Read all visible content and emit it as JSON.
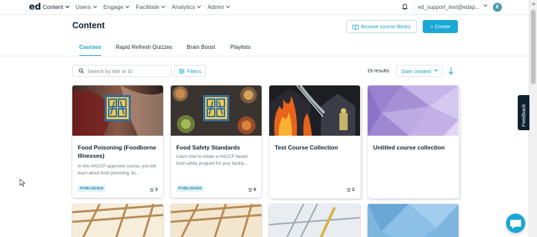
{
  "nav": {
    "logo": "ed",
    "items": [
      {
        "label": "Content",
        "active": true
      },
      {
        "label": "Users",
        "active": false
      },
      {
        "label": "Engage",
        "active": false
      },
      {
        "label": "Facilitate",
        "active": false
      },
      {
        "label": "Analytics",
        "active": false
      },
      {
        "label": "Admin",
        "active": false
      }
    ],
    "user_email": "ed_support_test@edap...",
    "avatar_initial": "E"
  },
  "header": {
    "title": "Content",
    "browse_label": "Browse course library",
    "create_label": "+ Create"
  },
  "tabs": [
    "Courses",
    "Rapid Refresh Quizzes",
    "Brain Boost",
    "Playlists"
  ],
  "active_tab": "Courses",
  "filters": {
    "search_placeholder": "Search by title or ID",
    "filters_label": "Filters",
    "results_text": "19 results",
    "sort_label": "Date created"
  },
  "cards": [
    {
      "title": "Food Poisoning (Foodborne Illnesses)",
      "description": "In this HACCP-approved course, you will learn about food poisoning, its...",
      "status": "PUBLISHED",
      "count": "3",
      "image": "stomach-pain-haccp-logo"
    },
    {
      "title": "Food Safety Standards",
      "description": "Learn how to create a HACCP based food safety program for your facility....",
      "status": "PUBLISHED",
      "count": "6",
      "image": "food-spread-haccp-logo"
    },
    {
      "title": "Test Course Collection",
      "description": "",
      "status": "",
      "count": "2",
      "image": "firefighter-house-fire"
    },
    {
      "title": "Untitled course collection",
      "description": "",
      "status": "",
      "count": "",
      "image": "purple-polygon-pattern"
    }
  ],
  "feedback_label": "Feedback",
  "colors": {
    "accent": "#19a8d6",
    "dark": "#0d2131",
    "badge_bg": "#e3f4f9"
  }
}
